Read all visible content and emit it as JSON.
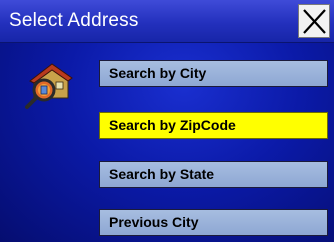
{
  "window": {
    "title": "Select Address",
    "close_icon": "close-icon"
  },
  "menu_icon": "house-search-icon",
  "menu": {
    "items": [
      {
        "label": "Search by City",
        "selected": false
      },
      {
        "label": "Search by ZipCode",
        "selected": true
      },
      {
        "label": "Search by State",
        "selected": false
      },
      {
        "label": "Previous City",
        "selected": false
      }
    ]
  },
  "colors": {
    "background": "#0b1aa8",
    "button": "#9bb3dc",
    "selected_button": "#ffff00"
  }
}
